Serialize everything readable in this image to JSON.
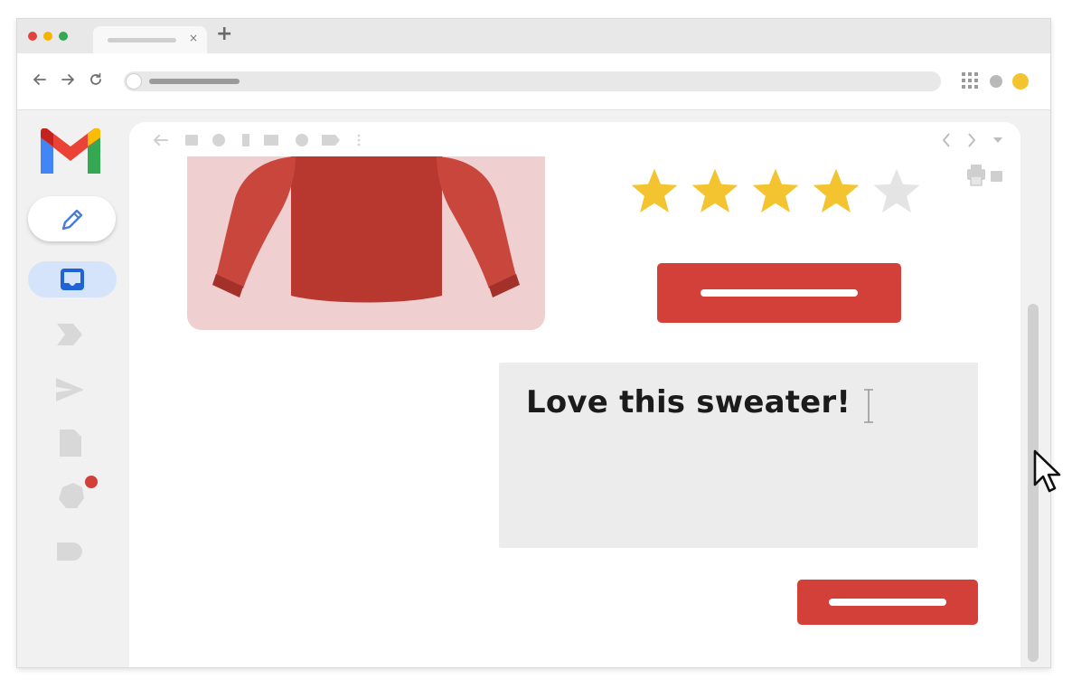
{
  "colors": {
    "brand_red": "#d3403a",
    "star_gold": "#f4c430",
    "star_empty": "#e4e4e4",
    "traffic_red": "#e0443e",
    "traffic_yellow": "#f5b400",
    "traffic_green": "#34a853",
    "inbox_highlight": "#d6e4fb",
    "sweater_red": "#b8372f"
  },
  "browser": {
    "tab_close": "×",
    "new_tab": "+",
    "nav_icons": [
      "back-arrow-icon",
      "forward-arrow-icon",
      "reload-icon"
    ],
    "right_icons": [
      "apps-grid-icon",
      "extension-dot-icon",
      "profile-avatar-icon"
    ]
  },
  "sidebar": {
    "logo": "gmail-logo-icon",
    "compose_icon": "pencil-icon",
    "items": [
      "inbox-icon",
      "important-icon",
      "sent-icon",
      "drafts-icon",
      "notification-icon",
      "label-icon"
    ]
  },
  "email": {
    "toolbar_icons": [
      "back-arrow-icon",
      "archive-icon",
      "report-icon",
      "delete-icon",
      "mail-icon",
      "snooze-icon",
      "label-icon",
      "more-icon"
    ],
    "rating": {
      "value": 4,
      "max": 5
    },
    "review_text": "Love this sweater!"
  }
}
